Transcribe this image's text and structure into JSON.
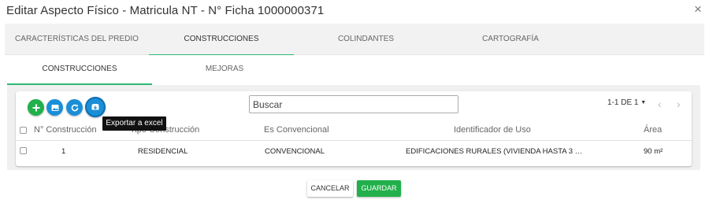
{
  "dialog": {
    "title": "Editar Aspecto Físico - Matricula NT - N° Ficha 1000000371",
    "close_icon": "×"
  },
  "tabs": [
    {
      "label": "CARACTERÍSTICAS DEL PREDIO",
      "active": false
    },
    {
      "label": "CONSTRUCCIONES",
      "active": true
    },
    {
      "label": "COLINDANTES",
      "active": false
    },
    {
      "label": "CARTOGRAFÍA",
      "active": false
    }
  ],
  "subtabs": [
    {
      "label": "CONSTRUCCIONES",
      "active": true
    },
    {
      "label": "MEJORAS",
      "active": false
    }
  ],
  "toolbar": {
    "buttons": [
      {
        "icon": "add-icon",
        "color": "#21b04b"
      },
      {
        "icon": "image-icon",
        "color": "#1a8fd6"
      },
      {
        "icon": "refresh-icon",
        "color": "#1a8fd6"
      },
      {
        "icon": "export-excel-icon",
        "color": "#1a8fd6"
      }
    ],
    "tooltip": "Exportar a excel",
    "search_placeholder": "Buscar"
  },
  "pagination": {
    "label": "1-1 DE 1",
    "caret": "▼",
    "prev": "‹",
    "next": "›"
  },
  "table": {
    "headers": [
      "N° Construcción",
      "Tipo Construcción",
      "Es Convencional",
      "Identificador de Uso",
      "Área"
    ],
    "rows": [
      [
        "1",
        "RESIDENCIAL",
        "CONVENCIONAL",
        "EDIFICACIONES RURALES (VIVIENDA HASTA 3 …",
        "90 m²"
      ]
    ]
  },
  "footer": {
    "cancel_label": "CANCELAR",
    "save_label": "GUARDAR"
  },
  "colors": {
    "accent_green": "#21b04b",
    "accent_blue": "#1a8fd6",
    "tab_underline": "#2eb872"
  }
}
